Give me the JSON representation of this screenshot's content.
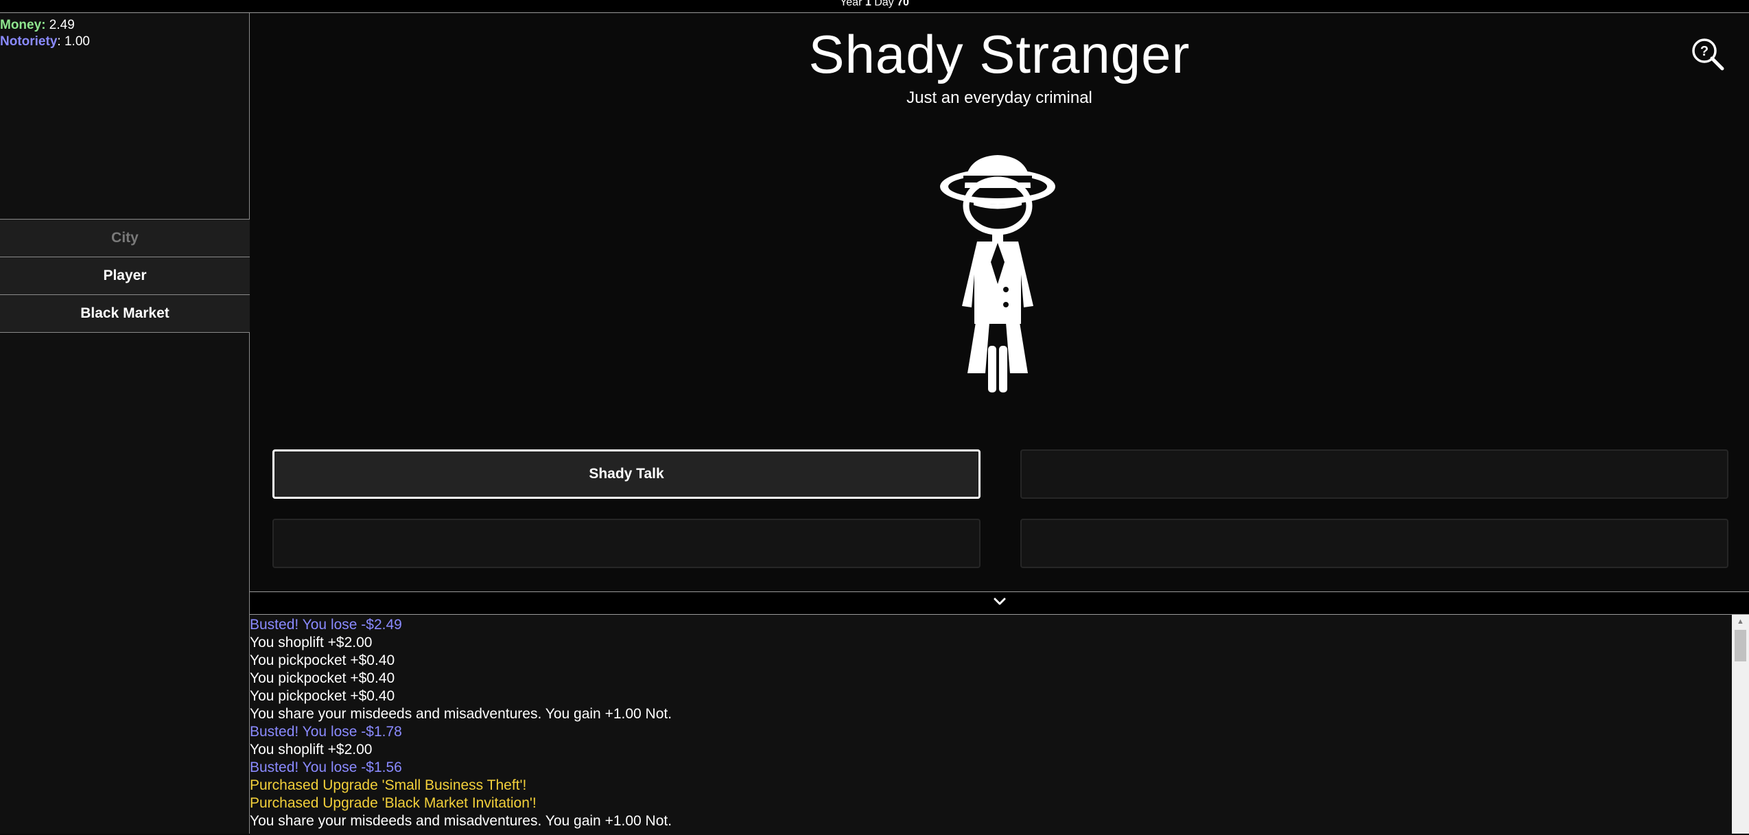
{
  "topbar": {
    "year_label": "Year",
    "year": "1",
    "day_label": "Day",
    "day": "70"
  },
  "stats": {
    "money_label": "Money",
    "money": "2.49",
    "notoriety_label": "Notoriety",
    "notoriety": "1.00",
    "money_color": "#8ee58e",
    "notoriety_color": "#8a8aff"
  },
  "nav": {
    "items": [
      {
        "label": "City",
        "disabled": true
      },
      {
        "label": "Player",
        "disabled": false
      },
      {
        "label": "Black Market",
        "disabled": false
      }
    ]
  },
  "main": {
    "title": "Shady Stranger",
    "subtitle": "Just an everyday criminal",
    "search_icon": "search-help-icon",
    "figure_icon": "shady-stranger-icon",
    "actions": [
      {
        "label": "Shady Talk",
        "active": true
      },
      {
        "label": "",
        "active": false
      },
      {
        "label": "",
        "active": false
      },
      {
        "label": "",
        "active": false
      }
    ]
  },
  "collapse": {
    "icon": "chevron-down-icon"
  },
  "log": {
    "lines": [
      {
        "text": "Busted! You lose -$2.49",
        "type": "busted"
      },
      {
        "text": "You shoplift +$2.00",
        "type": "normal"
      },
      {
        "text": "You pickpocket +$0.40",
        "type": "normal"
      },
      {
        "text": "You pickpocket +$0.40",
        "type": "normal"
      },
      {
        "text": "You pickpocket +$0.40",
        "type": "normal"
      },
      {
        "text": "You share your misdeeds and misadventures. You gain +1.00 Not.",
        "type": "normal"
      },
      {
        "text": "Busted! You lose -$1.78",
        "type": "busted"
      },
      {
        "text": "You shoplift +$2.00",
        "type": "normal"
      },
      {
        "text": "Busted! You lose -$1.56",
        "type": "busted"
      },
      {
        "text": "Purchased Upgrade 'Small Business Theft'!",
        "type": "purchase"
      },
      {
        "text": "Purchased Upgrade 'Black Market Invitation'!",
        "type": "purchase"
      },
      {
        "text": "You share your misdeeds and misadventures. You gain +1.00 Not.",
        "type": "normal"
      }
    ]
  },
  "colors": {
    "busted": "#8a8aff",
    "purchase": "#f2d03a",
    "background": "#0a0a0a"
  }
}
